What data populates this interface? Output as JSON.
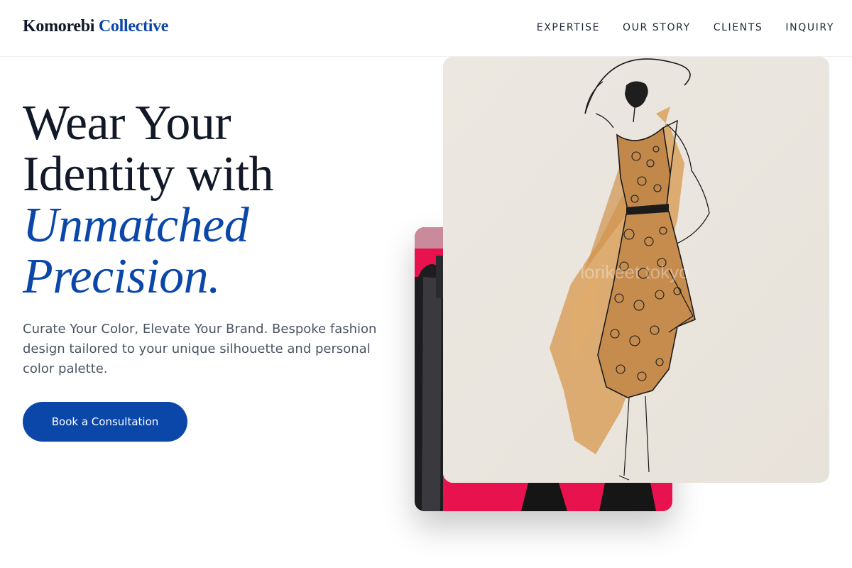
{
  "brand": {
    "name_main": "Komorebi",
    "name_accent": "Collective"
  },
  "nav": {
    "items": [
      {
        "label": "EXPERTISE"
      },
      {
        "label": "OUR STORY"
      },
      {
        "label": "CLIENTS"
      },
      {
        "label": "INQUIRY"
      }
    ]
  },
  "hero": {
    "title_line1": "Wear Your",
    "title_line2": "Identity with",
    "title_accent_line1": "Unmatched",
    "title_accent_line2": "Precision.",
    "subtitle": "Curate Your Color, Elevate Your Brand. Bespoke fashion design tailored to your unique silhouette and personal color palette.",
    "cta_label": "Book a Consultation"
  },
  "images": {
    "front_watermark": "lorikeet tokyo"
  },
  "colors": {
    "accent": "#0a47a9",
    "text_dark": "#111827",
    "text_muted": "#4b5563",
    "card_paper": "#ebe7e1",
    "watercolor": "#d9a15e",
    "backdrop_pink": "#e8134e"
  }
}
